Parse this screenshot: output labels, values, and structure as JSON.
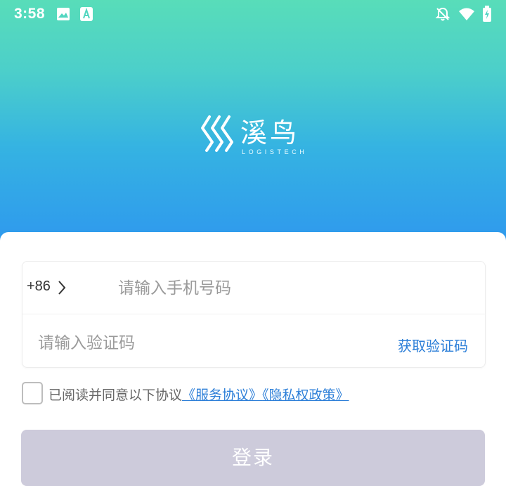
{
  "status_bar": {
    "time": "3:58",
    "icons": [
      "image-icon",
      "a-badge-icon",
      "bell-off-icon",
      "wifi-icon",
      "battery-icon"
    ]
  },
  "brand": {
    "name_cn": "溪鸟",
    "name_en": "LOGISTECH",
    "logo_icon": "chevrons-logo-icon"
  },
  "login_form": {
    "country_code": "+86",
    "phone_placeholder": "请输入手机号码",
    "code_placeholder": "请输入验证码",
    "get_code_label": "获取验证码"
  },
  "agreement": {
    "checked": false,
    "prefix_text": "已阅读并同意以下协议",
    "service_link": "《服务协议》",
    "privacy_link": "《隐私权政策》"
  },
  "login_button": {
    "label": "登录"
  },
  "colors": {
    "gradient_top": "#58ddb9",
    "gradient_bottom": "#2e96ef",
    "link": "#2d7fd8",
    "button_disabled": "#cdcbdb"
  }
}
